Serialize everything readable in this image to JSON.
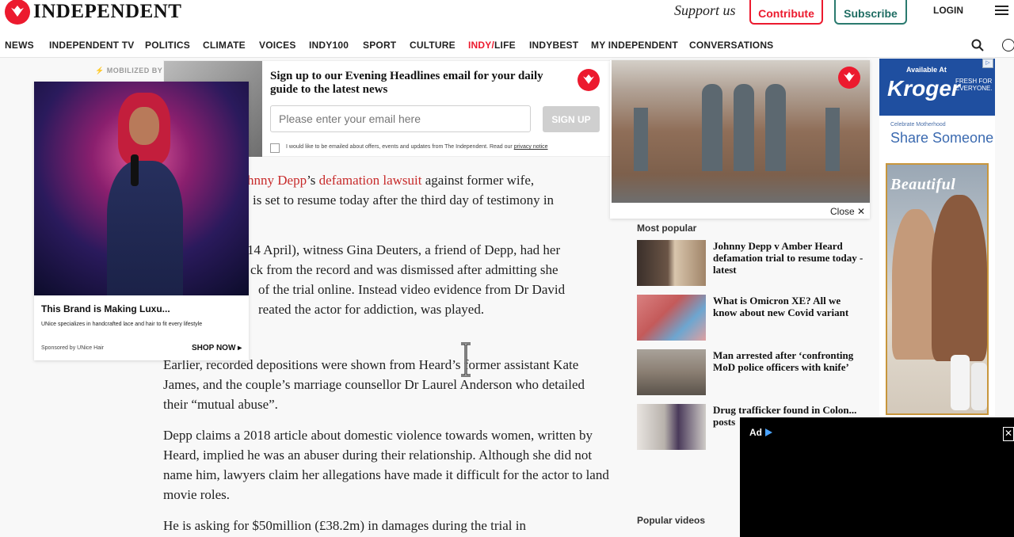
{
  "header": {
    "logo_text": "INDEPENDENT",
    "support_text": "Support us",
    "contribute_label": "Contribute",
    "subscribe_label": "Subscribe",
    "login_label": "LOGIN"
  },
  "nav": {
    "items": [
      "NEWS",
      "INDEPENDENT TV",
      "POLITICS",
      "CLIMATE",
      "VOICES",
      "INDY100",
      "SPORT",
      "CULTURE",
      "INDY/LIFE",
      "INDYBEST",
      "MY INDEPENDENT",
      "CONVERSATIONS"
    ],
    "indylife_red": "INDY/",
    "indylife_rest": "LIFE"
  },
  "newsletter": {
    "title": "Sign up to our Evening Headlines email for your daily guide to the latest news",
    "email_placeholder": "Please enter your email here",
    "signup_label": "SIGN UP",
    "consent_text": "I would like to be emailed about offers, events and updates from The Independent. Read our",
    "privacy_link": "privacy notice"
  },
  "left_ad": {
    "mobilized": "⚡ MOBILIZED BY",
    "title": "This Brand is Making Luxu...",
    "description": "UNice specializes in handcrafted lace and hair to fit every lifestyle",
    "sponsor": "Sponsored by UNice Hair",
    "shop_label": "SHOP NOW ▸"
  },
  "article": {
    "p1_link1": "hnny Depp",
    "p1_mid": "’s ",
    "p1_link2": "defamation lawsuit",
    "p1_after": " against former wife,",
    "p1_line2": "is set to resume today after the third day of testimony in",
    "p2_l1": "14 April), witness Gina Deuters, a friend of Depp, had her",
    "p2_l2": "ck from the record and was dismissed after admitting she",
    "p2_l3": "of the trial online. Instead video evidence from Dr David",
    "p2_l4": "reated the actor for addiction, was played.",
    "p3": "Earlier, recorded depositions were shown from Heard’s former assistant Kate James, and the couple’s marriage counsellor Dr Laurel Anderson who detailed their “mutual abuse”.",
    "p4": "Depp claims a 2018 article about domestic violence towards women, written by Heard, implied he was an abuser during their relationship. Although she did not name him, lawyers claim her allegations have made it difficult for the actor to land movie roles.",
    "p5": "He is asking for $50million (£38.2m) in damages during the trial in"
  },
  "video_player": {
    "close_label": "Close ✕"
  },
  "most_popular": {
    "title": "Most popular",
    "items": [
      "Johnny Depp v Amber Heard defamation trial to resume today - latest",
      "What is Omicron XE? All we know about new Covid variant",
      "Man arrested after ‘confronting MoD police officers with knife’",
      "Drug trafficker found in Colon... posts"
    ]
  },
  "popular_videos": {
    "title": "Popular videos"
  },
  "right_ad": {
    "available": "Available At",
    "brand": "Kroger",
    "fresh": "FRESH FOR EVERYONE.",
    "celebrate": "Celebrate Motherhood",
    "share": "Share Someone",
    "beautiful": "Beautiful",
    "adchoice": "▷"
  },
  "video_ad": {
    "label": "Ad",
    "close": "✕"
  },
  "colors": {
    "brand_red": "#ec1a2e",
    "subscribe_green": "#1f6d63",
    "link_red": "#c72a2a",
    "kroger_blue": "#1f4fa0"
  }
}
